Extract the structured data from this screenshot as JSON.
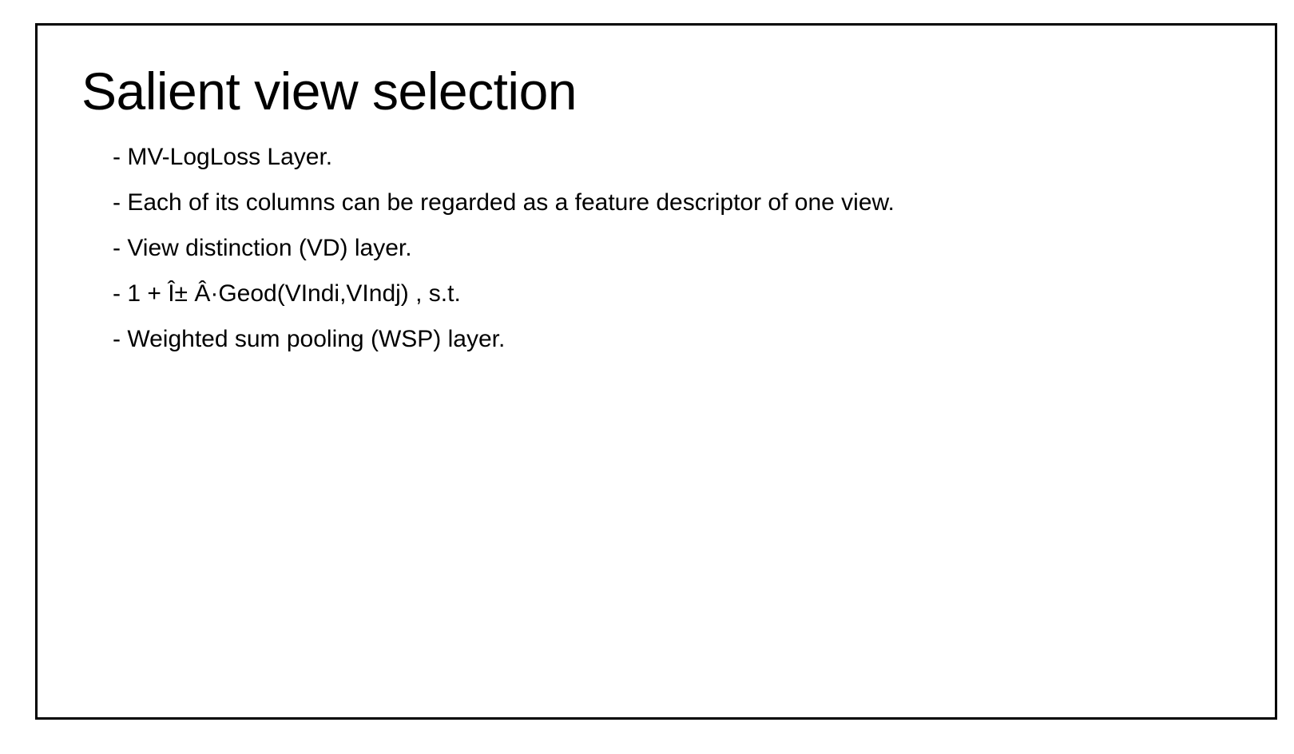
{
  "slide": {
    "title": "Salient view selection",
    "bullets": [
      "- MV-LogLoss Layer.",
      "- Each of its columns can be regarded as a feature descriptor of one view.",
      "- View distinction (VD) layer.",
      "- 1 + Î± Â·Geod(VIndi,VIndj) , s.t.",
      "- Weighted sum pooling (WSP) layer."
    ]
  },
  "colors": {
    "border": "#000000",
    "text": "#000000",
    "background": "#ffffff"
  }
}
